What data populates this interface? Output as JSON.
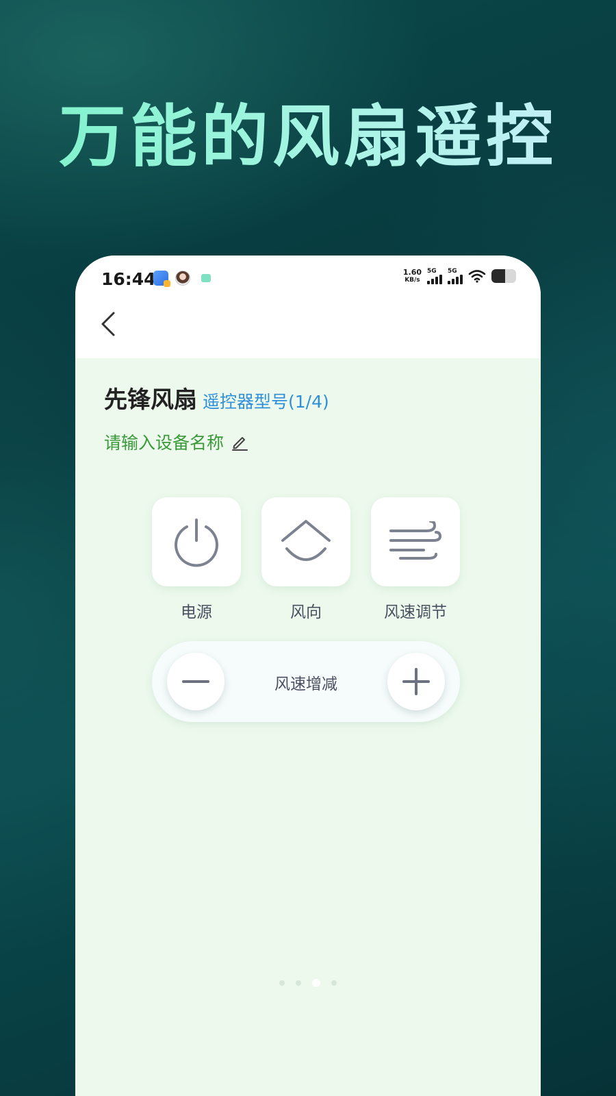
{
  "hero": {
    "title": "万能的风扇遥控"
  },
  "status_bar": {
    "time": "16:44",
    "net_speed_value": "1.60",
    "net_speed_unit": "KB/s",
    "sim1_label": "5G",
    "sim2_label": "5G",
    "battery_level": 0.55,
    "app_icons": [
      "files-icon",
      "avatar-icon",
      "green-app-icon"
    ]
  },
  "nav": {
    "back_icon": "chevron-left-icon"
  },
  "device": {
    "name": "先锋风扇",
    "model_link": "遥控器型号(1/4)",
    "rename_prompt": "请输入设备名称",
    "rename_icon": "pencil-icon"
  },
  "buttons": [
    {
      "label": "电源",
      "icon": "power-icon"
    },
    {
      "label": "风向",
      "icon": "fan-direction-icon"
    },
    {
      "label": "风速调节",
      "icon": "wind-speed-icon"
    }
  ],
  "speed_control": {
    "label": "风速增减",
    "minus_icon": "minus-icon",
    "plus_icon": "plus-icon"
  },
  "pager": {
    "count": 4,
    "active_index": 2
  },
  "colors": {
    "hero_title": "#8ff3d6",
    "page_bg": "#ecf9ec",
    "model_link": "#2f8fd8",
    "rename_prompt": "#3a9a3a",
    "icon_stroke": "#7c8290"
  }
}
